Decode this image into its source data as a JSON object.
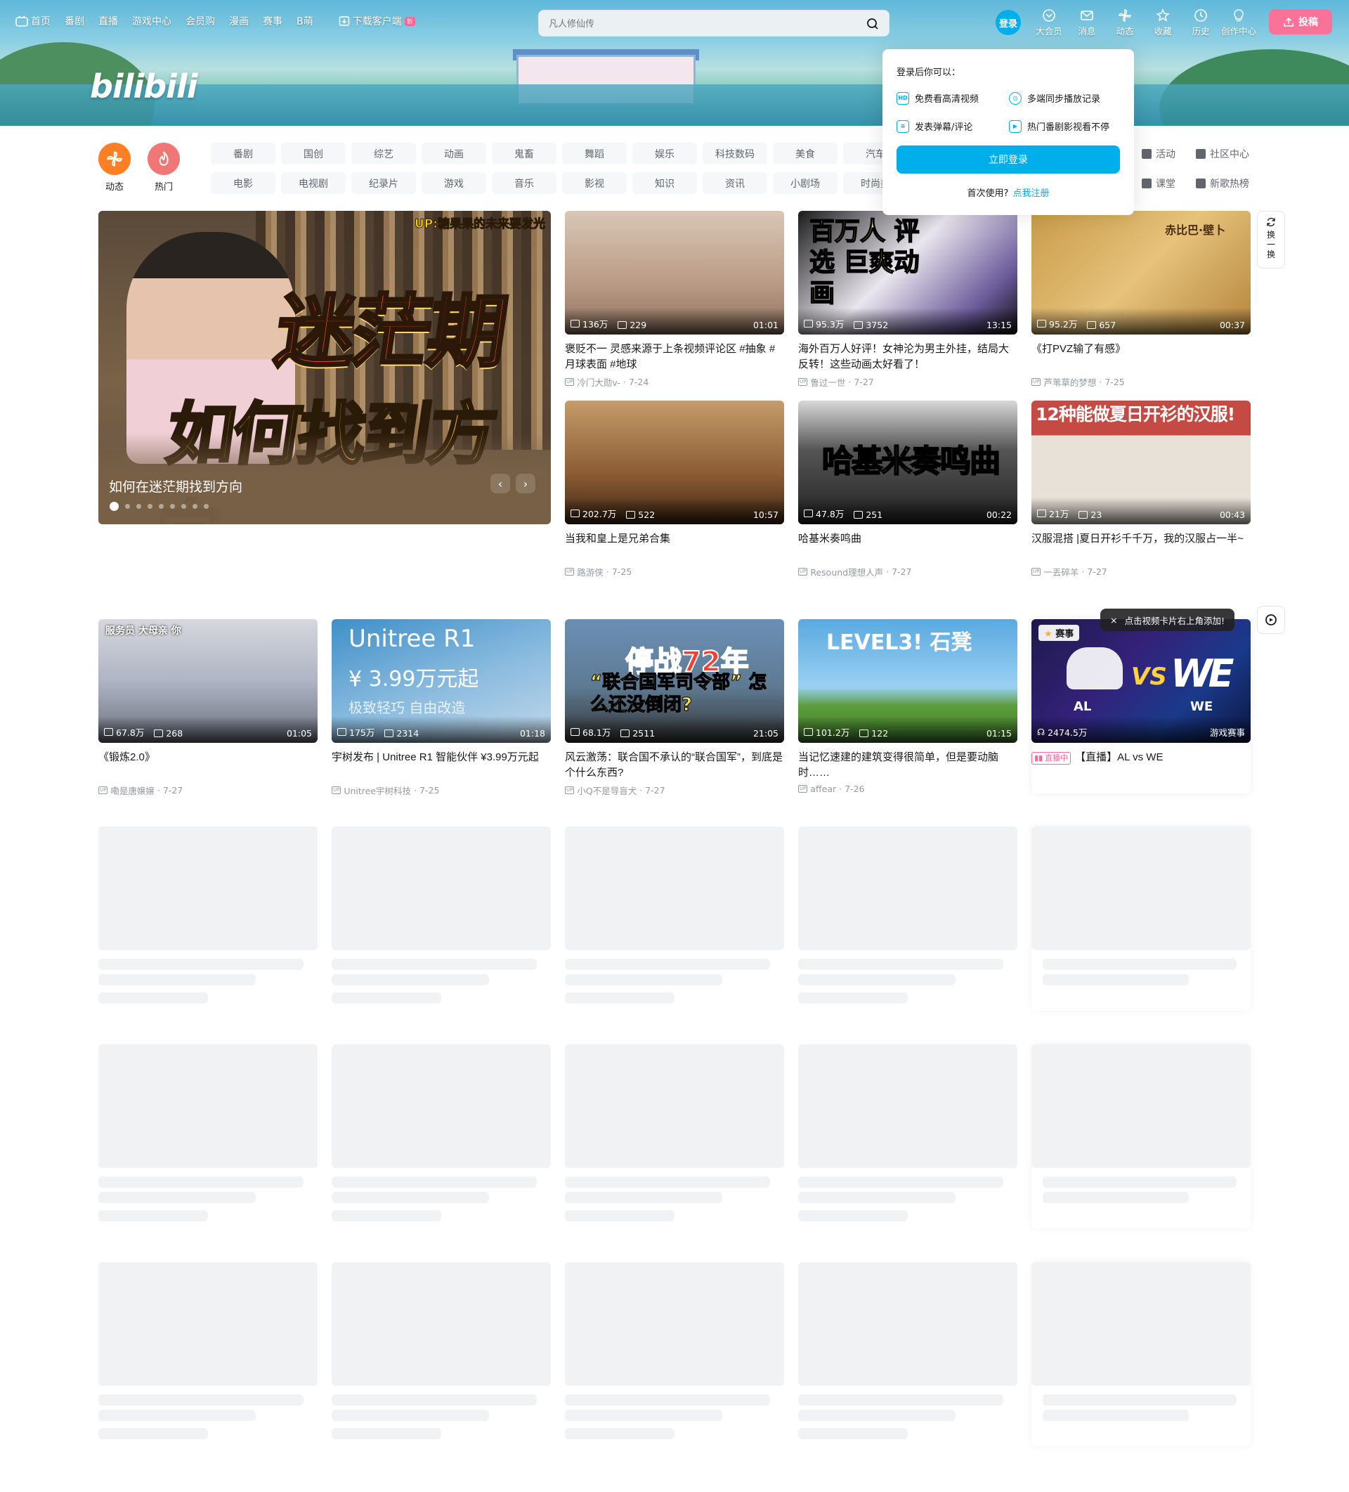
{
  "topnav": {
    "items": [
      "首页",
      "番剧",
      "直播",
      "游戏中心",
      "会员购",
      "漫画",
      "赛事",
      "B萌"
    ],
    "download": "下载客户端",
    "download_badge": "新"
  },
  "search": {
    "placeholder": "凡人修仙传"
  },
  "login_avatar": "登录",
  "right_nav": [
    "大会员",
    "消息",
    "动态",
    "收藏",
    "历史",
    "创作中心"
  ],
  "upload": "投稿",
  "login_popover": {
    "title": "登录后你可以：",
    "features": [
      "免费看高清视频",
      "多端同步播放记录",
      "发表弹幕/评论",
      "热门番剧影视看不停"
    ],
    "button": "立即登录",
    "first_use": "首次使用?",
    "register": "点我注册"
  },
  "channels": {
    "dynamic": "动态",
    "hot": "热门",
    "row1": [
      "番剧",
      "国创",
      "综艺",
      "动画",
      "鬼畜",
      "舞蹈",
      "娱乐",
      "科技数码",
      "美食",
      "汽车"
    ],
    "row2": [
      "电影",
      "电视剧",
      "纪录片",
      "游戏",
      "音乐",
      "影视",
      "知识",
      "资讯",
      "小剧场",
      "时尚美"
    ],
    "side": [
      "活动",
      "社区中心",
      "课堂",
      "新歌热榜"
    ]
  },
  "hero": {
    "up_tag": "UP:糖果果的未来要发光",
    "title_big_1": "迷茫期",
    "title_big_2": "如何找到方向",
    "caption": "如何在迷茫期找到方向",
    "prev": "‹",
    "next": "›"
  },
  "refresh": [
    "换",
    "一",
    "换"
  ],
  "tooltip": "点击视频卡片右上角添加!",
  "tooltip_close": "×",
  "videos": [
    {
      "views": "136万",
      "danmaku": "229",
      "duration": "01:01",
      "title": "褒贬不一 灵感来源于上条视频评论区 #抽象 #月球表面 #地球",
      "author": "冷门大勋v-",
      "date": "7-24",
      "overlay": ""
    },
    {
      "views": "95.3万",
      "danmaku": "3752",
      "duration": "13:15",
      "title": "海外百万人好评！女神沦为男主外挂，结局大反转！这些动画太好看了！",
      "author": "鲁过一世",
      "date": "7-27",
      "overlay": "百万人 评选 巨爽动画"
    },
    {
      "views": "95.2万",
      "danmaku": "657",
      "duration": "00:37",
      "title": "《打PVZ输了有感》",
      "author": "芦苇草的梦想",
      "date": "7-25",
      "overlay": "赤比巴·壁卜"
    },
    {
      "views": "202.7万",
      "danmaku": "522",
      "duration": "10:57",
      "title": "当我和皇上是兄弟合集",
      "author": "路游侠",
      "date": "7-25",
      "overlay": ""
    },
    {
      "views": "47.8万",
      "danmaku": "251",
      "duration": "00:22",
      "title": "哈基米奏鸣曲",
      "author": "Resound理想人声",
      "date": "7-27",
      "overlay": "哈基米奏鸣曲"
    },
    {
      "views": "21万",
      "danmaku": "23",
      "duration": "00:43",
      "title": "汉服混搭 |夏日开衫千千万，我的汉服占一半~",
      "author": "一丢碎羊",
      "date": "7-27",
      "overlay": "12种能做夏日开衫的汉服!"
    },
    {
      "views": "67.8万",
      "danmaku": "268",
      "duration": "01:05",
      "title": "《锻炼2.0》",
      "author": "嘞是唐嬢嬢",
      "date": "7-27",
      "overlay": "服务员 大母亲 你"
    },
    {
      "views": "175万",
      "danmaku": "2314",
      "duration": "01:18",
      "title": "宇树发布 | Unitree R1 智能伙伴 ¥3.99万元起",
      "author": "Unitree宇树科技",
      "date": "7-25",
      "overlay": "Unitree R1"
    },
    {
      "views": "68.1万",
      "danmaku": "2511",
      "duration": "21:05",
      "title": "风云激荡：联合国不承认的“联合国军”，到底是个什么东西?",
      "author": "小Q不是导盲犬",
      "date": "7-27",
      "overlay": "停战72年"
    },
    {
      "views": "101.2万",
      "danmaku": "122",
      "duration": "01:15",
      "title": "当记忆速建的建筑变得很简单，但是要动脑时……",
      "author": "affear",
      "date": "7-26",
      "overlay": "LEVEL3! 石凳"
    }
  ],
  "unitree_sub": {
    "price": "¥ 3.99万元起",
    "tag": "极致轻巧  自由改造"
  },
  "ceasefire_sub": "“联合国军司令部” 怎么还没倒闭?",
  "live_card": {
    "badge": "赛事",
    "team_a": "AL",
    "team_b": "WE",
    "vs": "VS",
    "viewers": "2474.5万",
    "category": "游戏赛事",
    "live_tag": "直播中",
    "title": "【直播】AL vs WE"
  },
  "colors": {
    "brand_blue": "#00aeec",
    "brand_pink": "#fb7299",
    "hot_red": "#f07775",
    "dynamic_orange": "#ff7f24"
  }
}
